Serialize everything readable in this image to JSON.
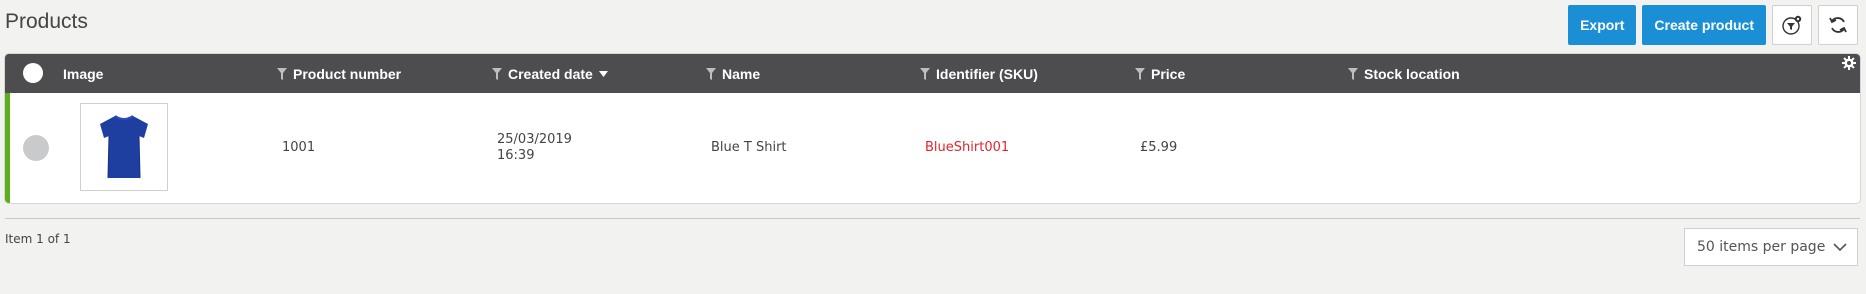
{
  "page": {
    "title": "Products"
  },
  "toolbar": {
    "export_label": "Export",
    "create_label": "Create product",
    "filter_icon": "filter-settings-icon",
    "refresh_icon": "refresh-icon"
  },
  "grid": {
    "columns": [
      {
        "label": "Image"
      },
      {
        "label": "Product number"
      },
      {
        "label": "Created date"
      },
      {
        "label": "Name"
      },
      {
        "label": "Identifier (SKU)"
      },
      {
        "label": "Price"
      },
      {
        "label": "Stock location"
      }
    ],
    "sorted_column": "Created date",
    "rows": [
      {
        "image": "blue-tshirt-image",
        "product_number": "1001",
        "created_date": "25/03/2019",
        "created_time": "16:39",
        "name": "Blue T Shirt",
        "sku": "BlueShirt001",
        "price": "£5.99",
        "stock_location": ""
      }
    ]
  },
  "footer": {
    "item_info": "Item 1 of 1",
    "per_page": "50 items per page"
  },
  "colors": {
    "primary": "#1a8fd6",
    "header_bg": "#4d4d4f",
    "row_accent": "#5cae1a",
    "sku_text": "#e0262b"
  }
}
